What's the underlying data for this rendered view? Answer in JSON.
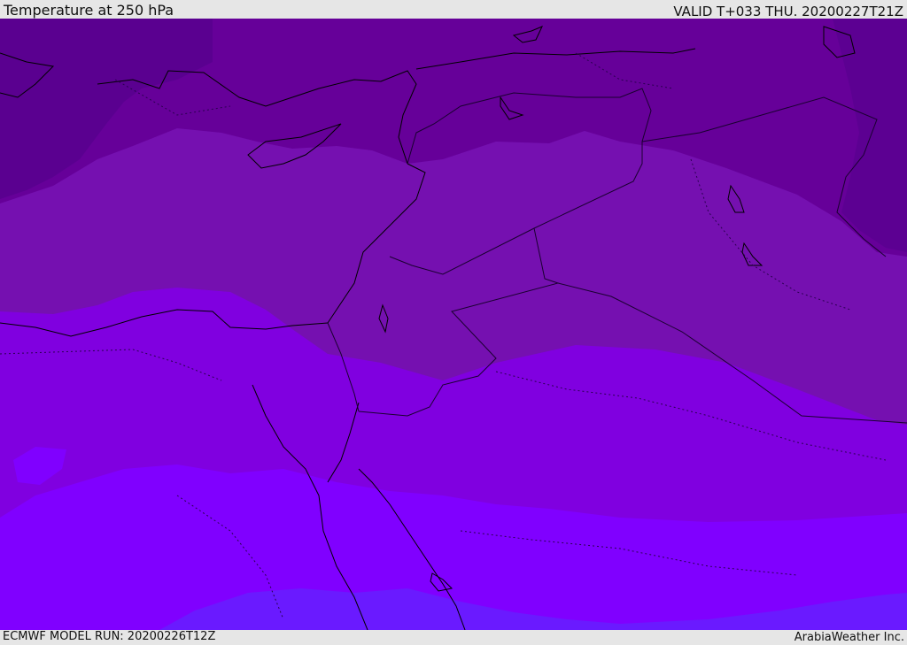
{
  "header": {
    "title": "Temperature at 250 hPa",
    "valid_time": "VALID T+033 THU. 20200227T21Z"
  },
  "footer": {
    "model_run": "ECMWF MODEL RUN: 20200226T12Z",
    "credit": "ArabiaWeather Inc."
  },
  "map": {
    "variable": "temperature",
    "pressure_level": "250 hPa",
    "colors": {
      "band_coldest": "#5a0090",
      "band_2": "#660099",
      "band_3": "#7510b0",
      "band_4": "#7f00dd",
      "band_5": "#8000ff",
      "band_warmest": "#6a1aff",
      "coastline": "#000000",
      "internal_border": "#1a0030"
    }
  }
}
